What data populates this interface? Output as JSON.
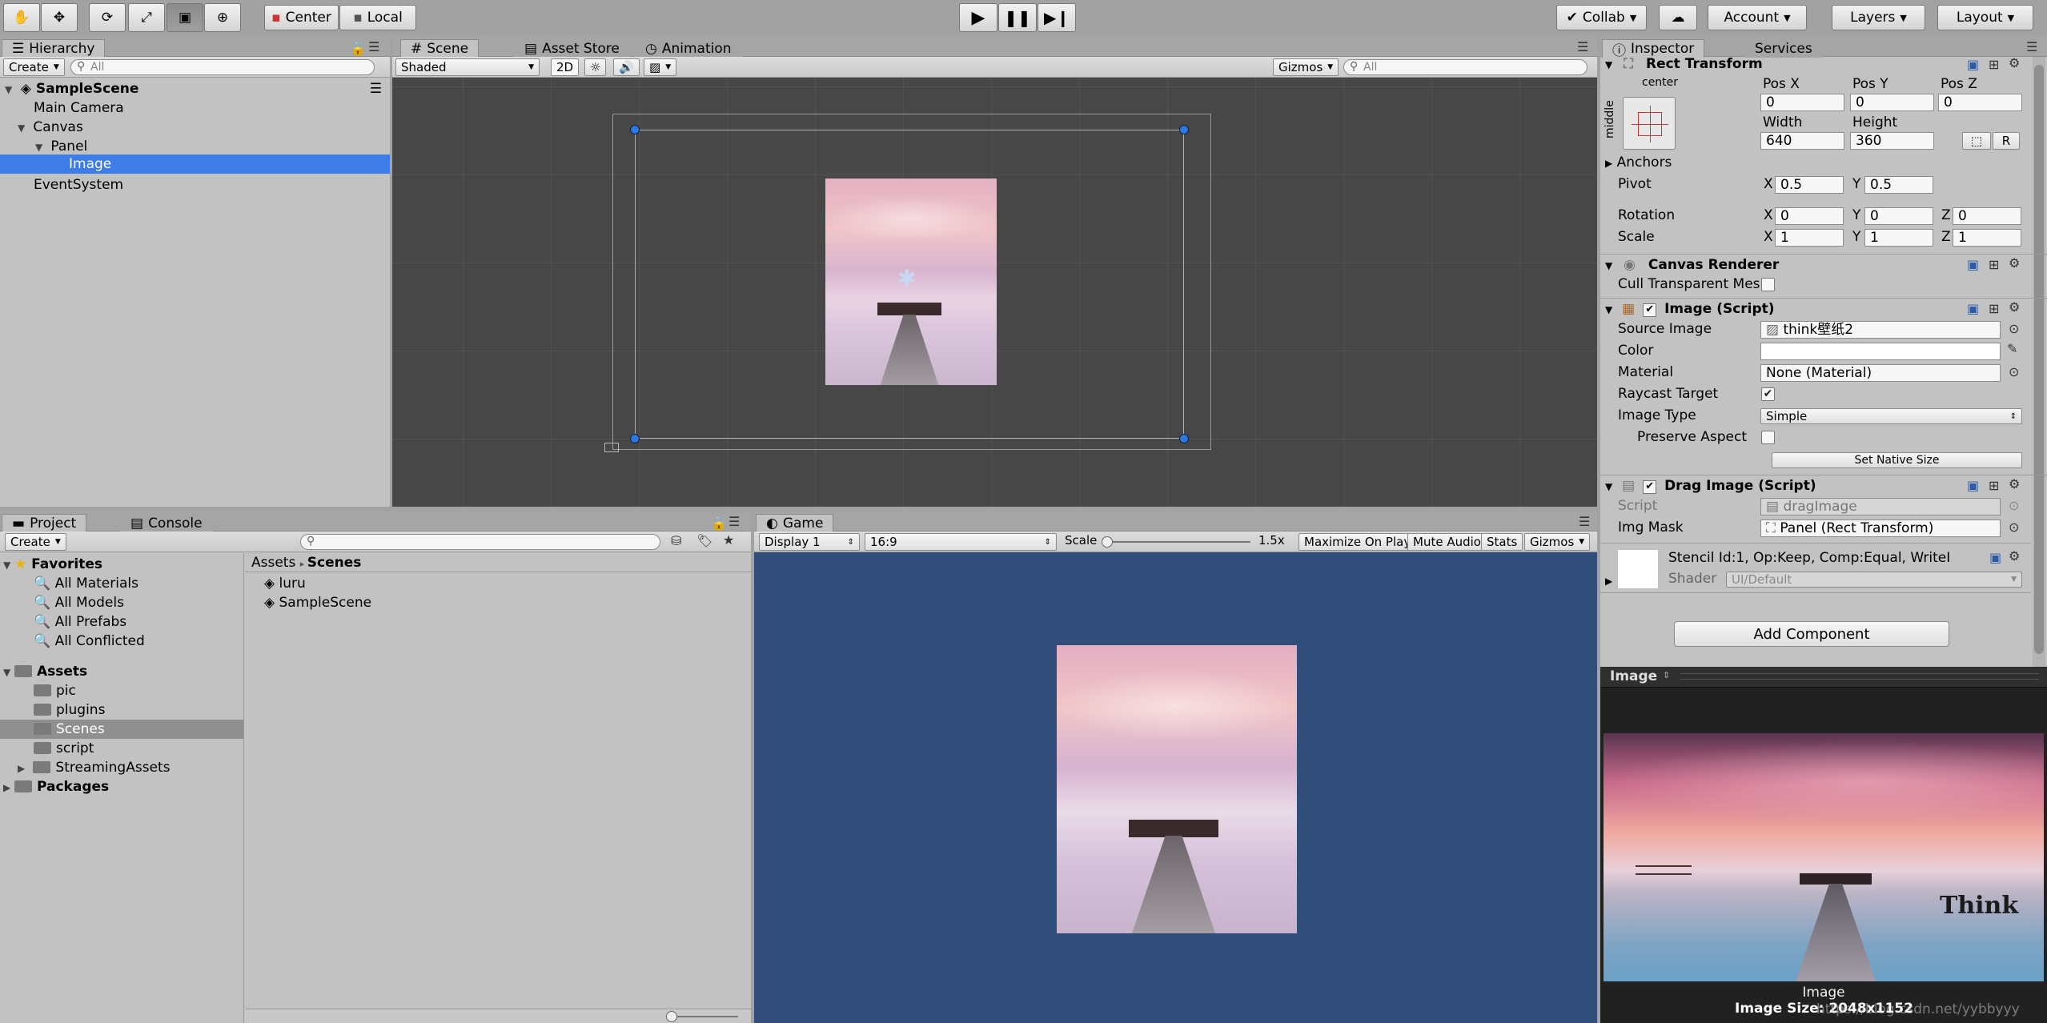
{
  "toolbar": {
    "center_label": "Center",
    "local_label": "Local",
    "collab_label": "Collab",
    "account_label": "Account",
    "layers_label": "Layers",
    "layout_label": "Layout"
  },
  "hierarchy": {
    "tab": "Hierarchy",
    "create": "Create",
    "search_placeholder": "All",
    "scene": "SampleScene",
    "items": [
      "Main Camera",
      "Canvas",
      "Panel",
      "Image",
      "EventSystem"
    ]
  },
  "scene_view": {
    "tabs": [
      "Scene",
      "Asset Store",
      "Animation"
    ],
    "shading": "Shaded",
    "mode_2d": "2D",
    "gizmos": "Gizmos",
    "search_placeholder": "All"
  },
  "project": {
    "tabs": [
      "Project",
      "Console"
    ],
    "create": "Create",
    "favorites_label": "Favorites",
    "favorites": [
      "All Materials",
      "All Models",
      "All Prefabs",
      "All Conflicted"
    ],
    "assets_label": "Assets",
    "assets": [
      "pic",
      "plugins",
      "Scenes",
      "script",
      "StreamingAssets"
    ],
    "packages_label": "Packages",
    "breadcrumb_root": "Assets",
    "breadcrumb_current": "Scenes",
    "files": [
      "luru",
      "SampleScene"
    ]
  },
  "game_view": {
    "tab": "Game",
    "display": "Display 1",
    "aspect": "16:9",
    "scale_label": "Scale",
    "scale_value": "1.5x",
    "maximize": "Maximize On Play",
    "mute": "Mute Audio",
    "stats": "Stats",
    "gizmos": "Gizmos"
  },
  "inspector": {
    "tabs": [
      "Inspector",
      "Services"
    ],
    "rect_transform": {
      "title": "Rect Transform",
      "anchor_h": "center",
      "anchor_v": "middle",
      "pos_x_label": "Pos X",
      "pos_y_label": "Pos Y",
      "pos_z_label": "Pos Z",
      "pos_x": "0",
      "pos_y": "0",
      "pos_z": "0",
      "width_label": "Width",
      "height_label": "Height",
      "width": "640",
      "height": "360",
      "r_btn": "R",
      "anchors": "Anchors",
      "pivot_label": "Pivot",
      "pivot_x": "0.5",
      "pivot_y": "0.5",
      "rotation_label": "Rotation",
      "rot_x": "0",
      "rot_y": "0",
      "rot_z": "0",
      "scale_label": "Scale",
      "scale_x": "1",
      "scale_y": "1",
      "scale_z": "1",
      "x": "X",
      "y": "Y",
      "z": "Z"
    },
    "canvas_renderer": {
      "title": "Canvas Renderer",
      "cull_label": "Cull Transparent Mes"
    },
    "image_script": {
      "title": "Image (Script)",
      "source_label": "Source Image",
      "source_value": "think壁纸2",
      "color_label": "Color",
      "material_label": "Material",
      "material_value": "None (Material)",
      "raycast_label": "Raycast Target",
      "type_label": "Image Type",
      "type_value": "Simple",
      "preserve_label": "Preserve Aspect",
      "native_btn": "Set Native Size"
    },
    "drag_image": {
      "title": "Drag Image (Script)",
      "script_label": "Script",
      "script_value": "dragImage",
      "mask_label": "Img Mask",
      "mask_value": "Panel (Rect Transform)"
    },
    "material": {
      "stencil": "Stencil Id:1, Op:Keep, Comp:Equal, WriteI",
      "shader_label": "Shader",
      "shader_value": "UI/Default"
    },
    "add_component": "Add Component"
  },
  "preview": {
    "title": "Image",
    "caption": "Image",
    "size": "Image Size: 2048x1152",
    "logo_text": "Think",
    "watermark": "https://blog.csdn.net/yybbyyy"
  }
}
